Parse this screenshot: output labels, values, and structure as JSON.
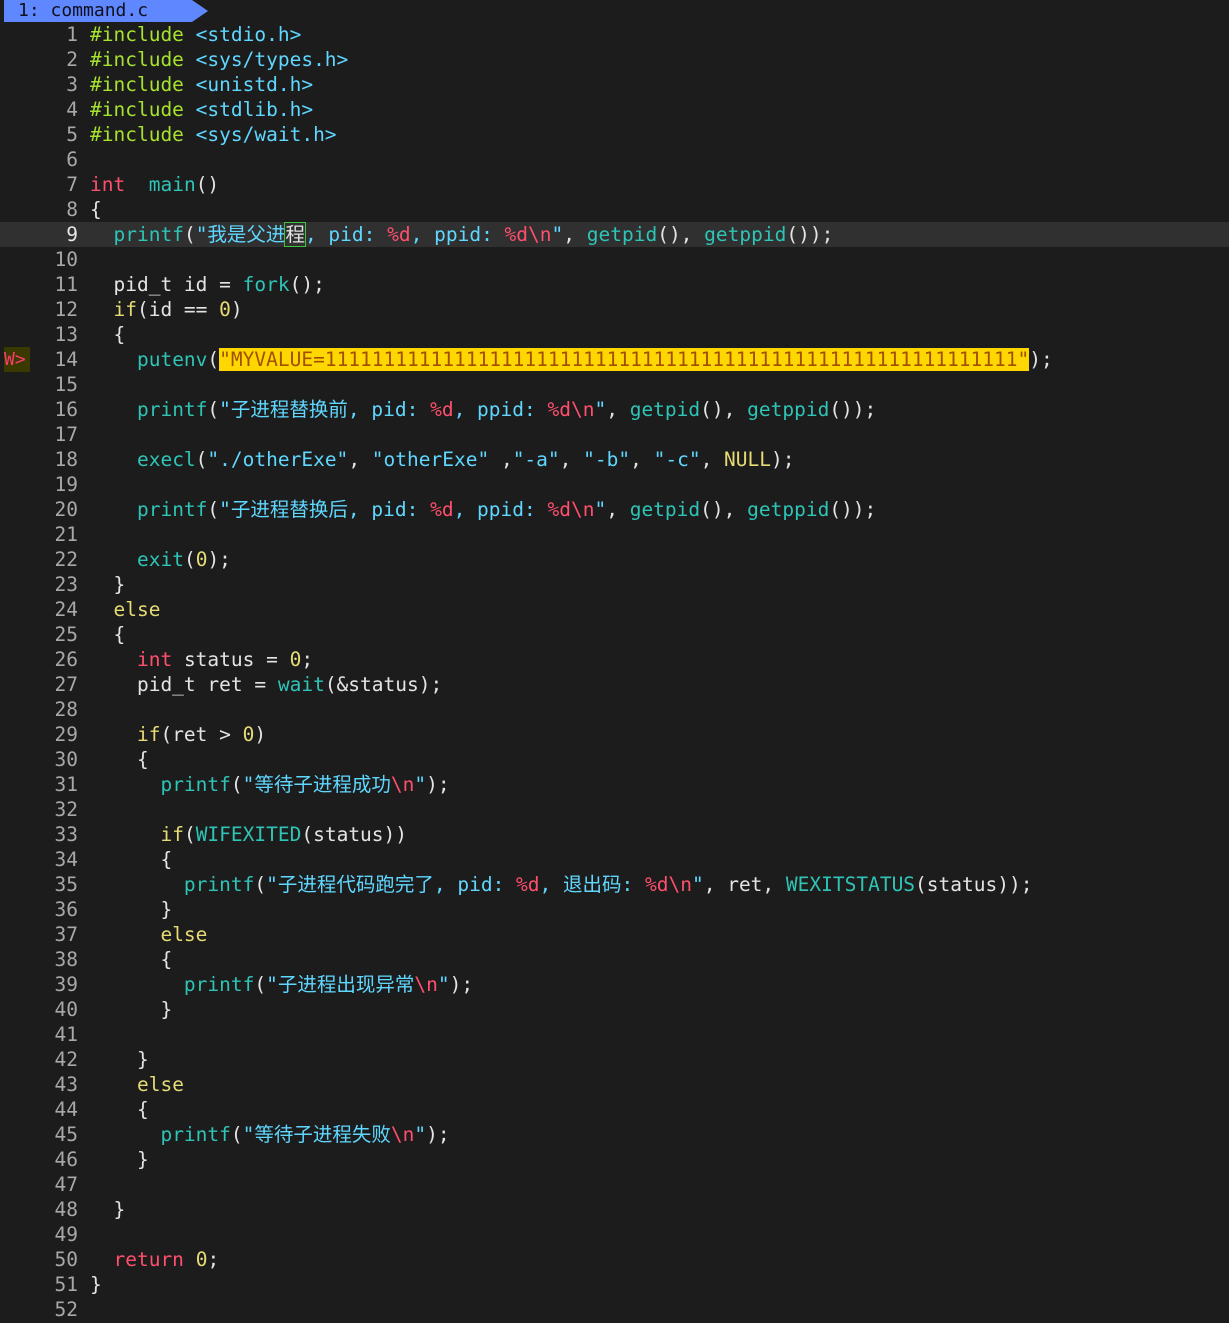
{
  "tab": {
    "label": "1: command.c"
  },
  "sign": {
    "text": "W>",
    "line": 14
  },
  "cursor_line": 9,
  "lines": [
    [
      [
        "pre",
        "#include "
      ],
      [
        "inc",
        "<stdio.h>"
      ]
    ],
    [
      [
        "pre",
        "#include "
      ],
      [
        "inc",
        "<sys/types.h>"
      ]
    ],
    [
      [
        "pre",
        "#include "
      ],
      [
        "inc",
        "<unistd.h>"
      ]
    ],
    [
      [
        "pre",
        "#include "
      ],
      [
        "inc",
        "<stdlib.h>"
      ]
    ],
    [
      [
        "pre",
        "#include "
      ],
      [
        "inc",
        "<sys/wait.h>"
      ]
    ],
    [],
    [
      [
        "kw",
        "int"
      ],
      [
        "",
        "  "
      ],
      [
        "fn",
        "main"
      ],
      [
        "",
        "()"
      ]
    ],
    [
      [
        "",
        "{"
      ]
    ],
    [
      [
        "",
        "  "
      ],
      [
        "fn",
        "printf"
      ],
      [
        "",
        "("
      ],
      [
        "str",
        "\"我是父进"
      ],
      [
        "cursor",
        "程"
      ],
      [
        "str",
        ", pid: "
      ],
      [
        "fmt",
        "%d"
      ],
      [
        "str",
        ", ppid: "
      ],
      [
        "fmt",
        "%d\\n"
      ],
      [
        "str",
        "\""
      ],
      [
        "",
        ", "
      ],
      [
        "fn",
        "getpid"
      ],
      [
        "",
        "(), "
      ],
      [
        "fn",
        "getppid"
      ],
      [
        "",
        "());"
      ]
    ],
    [],
    [
      [
        "",
        "  pid_t id = "
      ],
      [
        "fn",
        "fork"
      ],
      [
        "",
        "();"
      ]
    ],
    [
      [
        "",
        "  "
      ],
      [
        "kw2",
        "if"
      ],
      [
        "",
        "(id == "
      ],
      [
        "num",
        "0"
      ],
      [
        "",
        ")"
      ]
    ],
    [
      [
        "",
        "  {"
      ]
    ],
    [
      [
        "",
        "    "
      ],
      [
        "fn",
        "putenv"
      ],
      [
        "",
        "("
      ],
      [
        "warnhl",
        "\"MYVALUE=11111111111111111111111111111111111111111111111111111111111\""
      ],
      [
        "",
        ");"
      ]
    ],
    [],
    [
      [
        "",
        "    "
      ],
      [
        "fn",
        "printf"
      ],
      [
        "",
        "("
      ],
      [
        "str",
        "\"子进程替换前, pid: "
      ],
      [
        "fmt",
        "%d"
      ],
      [
        "str",
        ", ppid: "
      ],
      [
        "fmt",
        "%d\\n"
      ],
      [
        "str",
        "\""
      ],
      [
        "",
        ", "
      ],
      [
        "fn",
        "getpid"
      ],
      [
        "",
        "(), "
      ],
      [
        "fn",
        "getppid"
      ],
      [
        "",
        "());"
      ]
    ],
    [],
    [
      [
        "",
        "    "
      ],
      [
        "fn",
        "execl"
      ],
      [
        "",
        "("
      ],
      [
        "str",
        "\"./otherExe\""
      ],
      [
        "",
        ", "
      ],
      [
        "str",
        "\"otherExe\""
      ],
      [
        "",
        " ,"
      ],
      [
        "str",
        "\"-a\""
      ],
      [
        "",
        ", "
      ],
      [
        "str",
        "\"-b\""
      ],
      [
        "",
        ", "
      ],
      [
        "str",
        "\"-c\""
      ],
      [
        "",
        ", "
      ],
      [
        "null",
        "NULL"
      ],
      [
        "",
        ");"
      ]
    ],
    [],
    [
      [
        "",
        "    "
      ],
      [
        "fn",
        "printf"
      ],
      [
        "",
        "("
      ],
      [
        "str",
        "\"子进程替换后, pid: "
      ],
      [
        "fmt",
        "%d"
      ],
      [
        "str",
        ", ppid: "
      ],
      [
        "fmt",
        "%d\\n"
      ],
      [
        "str",
        "\""
      ],
      [
        "",
        ", "
      ],
      [
        "fn",
        "getpid"
      ],
      [
        "",
        "(), "
      ],
      [
        "fn",
        "getppid"
      ],
      [
        "",
        "());"
      ]
    ],
    [],
    [
      [
        "",
        "    "
      ],
      [
        "fn",
        "exit"
      ],
      [
        "",
        "("
      ],
      [
        "num",
        "0"
      ],
      [
        "",
        ");"
      ]
    ],
    [
      [
        "",
        "  }"
      ]
    ],
    [
      [
        "",
        "  "
      ],
      [
        "kw2",
        "else"
      ]
    ],
    [
      [
        "",
        "  {"
      ]
    ],
    [
      [
        "",
        "    "
      ],
      [
        "kw",
        "int"
      ],
      [
        "",
        " status = "
      ],
      [
        "num",
        "0"
      ],
      [
        "",
        ";"
      ]
    ],
    [
      [
        "",
        "    pid_t ret = "
      ],
      [
        "fn",
        "wait"
      ],
      [
        "",
        "(&status);"
      ]
    ],
    [],
    [
      [
        "",
        "    "
      ],
      [
        "kw2",
        "if"
      ],
      [
        "",
        "(ret > "
      ],
      [
        "num",
        "0"
      ],
      [
        "",
        ")"
      ]
    ],
    [
      [
        "",
        "    {"
      ]
    ],
    [
      [
        "",
        "      "
      ],
      [
        "fn",
        "printf"
      ],
      [
        "",
        "("
      ],
      [
        "str",
        "\"等待子进程成功"
      ],
      [
        "fmt",
        "\\n"
      ],
      [
        "str",
        "\""
      ],
      [
        "",
        ");"
      ]
    ],
    [],
    [
      [
        "",
        "      "
      ],
      [
        "kw2",
        "if"
      ],
      [
        "",
        "("
      ],
      [
        "mac",
        "WIFEXITED"
      ],
      [
        "",
        "(status))"
      ]
    ],
    [
      [
        "",
        "      {"
      ]
    ],
    [
      [
        "",
        "        "
      ],
      [
        "fn",
        "printf"
      ],
      [
        "",
        "("
      ],
      [
        "str",
        "\"子进程代码跑完了, pid: "
      ],
      [
        "fmt",
        "%d"
      ],
      [
        "str",
        ", 退出码: "
      ],
      [
        "fmt",
        "%d\\n"
      ],
      [
        "str",
        "\""
      ],
      [
        "",
        ", ret, "
      ],
      [
        "mac",
        "WEXITSTATUS"
      ],
      [
        "",
        "(status));"
      ]
    ],
    [
      [
        "",
        "      }"
      ]
    ],
    [
      [
        "",
        "      "
      ],
      [
        "kw2",
        "else"
      ]
    ],
    [
      [
        "",
        "      {"
      ]
    ],
    [
      [
        "",
        "        "
      ],
      [
        "fn",
        "printf"
      ],
      [
        "",
        "("
      ],
      [
        "str",
        "\"子进程出现异常"
      ],
      [
        "fmt",
        "\\n"
      ],
      [
        "str",
        "\""
      ],
      [
        "",
        ");"
      ]
    ],
    [
      [
        "",
        "      }"
      ]
    ],
    [],
    [
      [
        "",
        "    }"
      ]
    ],
    [
      [
        "",
        "    "
      ],
      [
        "kw2",
        "else"
      ]
    ],
    [
      [
        "",
        "    {"
      ]
    ],
    [
      [
        "",
        "      "
      ],
      [
        "fn",
        "printf"
      ],
      [
        "",
        "("
      ],
      [
        "str",
        "\"等待子进程失败"
      ],
      [
        "fmt",
        "\\n"
      ],
      [
        "str",
        "\""
      ],
      [
        "",
        ");"
      ]
    ],
    [
      [
        "",
        "    }"
      ]
    ],
    [],
    [
      [
        "",
        "  }"
      ]
    ],
    [],
    [
      [
        "",
        "  "
      ],
      [
        "kw",
        "return"
      ],
      [
        "",
        " "
      ],
      [
        "num",
        "0"
      ],
      [
        "",
        ";"
      ]
    ],
    [
      [
        "",
        "}"
      ]
    ],
    []
  ],
  "colors": {
    "background": "#1c1c1c",
    "tab": "#5f87ff",
    "cursorline": "#303030",
    "warning_highlight": "#ffd700",
    "keyword": "#ff4f6d",
    "preproc": "#a6e22e",
    "function": "#2ec4b6",
    "string": "#5fd7ff",
    "number": "#e6db74"
  }
}
